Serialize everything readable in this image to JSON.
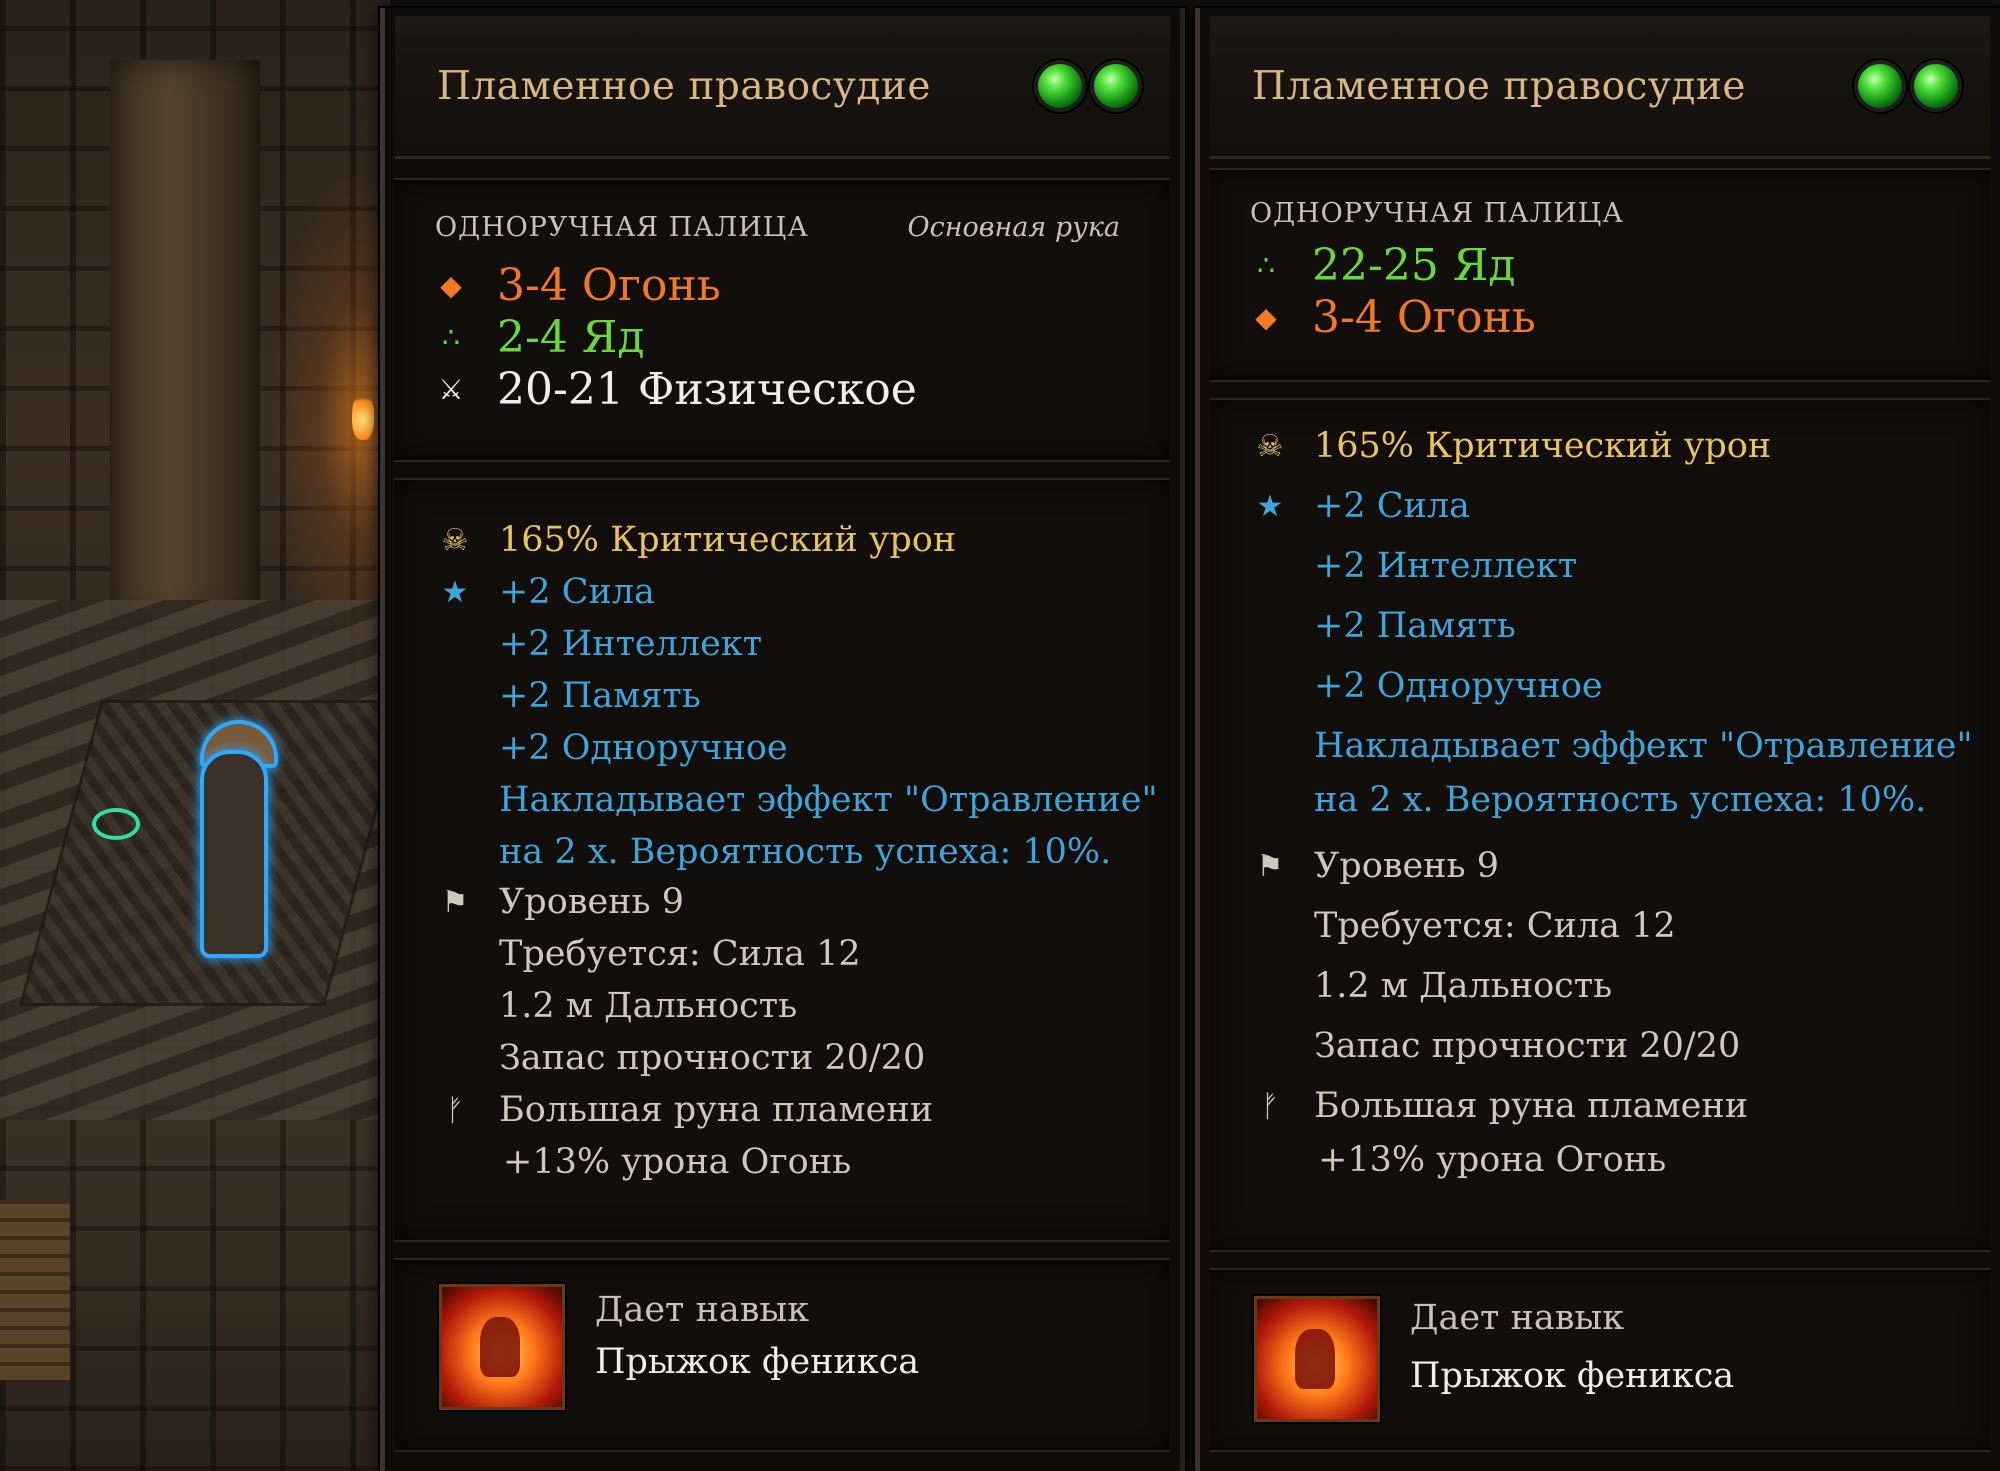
{
  "left_panel": {
    "title": "Пламенное правосудие",
    "weapon_type": "ОДНОРУЧНАЯ ПАЛИЦА",
    "hand": "Основная рука",
    "damage": [
      {
        "icon": "fire-icon",
        "text": "3-4 Огонь",
        "color": "#f07a22"
      },
      {
        "icon": "poison-icon",
        "text": "2-4 Яд",
        "color": "#6ad83a"
      },
      {
        "icon": "crossed-swords-icon",
        "text": "20-21 Физическое",
        "color": "#f2eee6"
      }
    ],
    "crit": "165% Критический урон",
    "bonuses": [
      "+2 Сила",
      "+2 Интеллект",
      "+2 Память",
      "+2 Одноручное"
    ],
    "effect_line1": "Накладывает эффект \"Отравление\"",
    "effect_line2": "на 2 х. Вероятность успеха: 10%.",
    "level": "Уровень 9",
    "requires": "Требуется: Сила 12",
    "range": "1.2 м Дальность",
    "durability": "Запас прочности  20/20",
    "rune_name": "Большая руна пламени",
    "rune_bonus": "+13% урона Огонь",
    "skill_label": "Дает навык",
    "skill_name": "Прыжок феникса"
  },
  "right_panel": {
    "title": "Пламенное правосудие",
    "weapon_type": "ОДНОРУЧНАЯ ПАЛИЦА",
    "damage": [
      {
        "icon": "poison-icon",
        "text": "22-25 Яд",
        "color": "#6ad83a"
      },
      {
        "icon": "fire-icon",
        "text": "3-4 Огонь",
        "color": "#f07a22"
      }
    ],
    "crit": "165% Критический урон",
    "bonuses": [
      "+2 Сила",
      "+2 Интеллект",
      "+2 Память",
      "+2 Одноручное"
    ],
    "effect_line1": "Накладывает эффект \"Отравление\"",
    "effect_line2": "на 2 х. Вероятность успеха: 10%.",
    "level": "Уровень 9",
    "requires": "Требуется: Сила 12",
    "range": "1.2 м Дальность",
    "durability": "Запас прочности  20/20",
    "rune_name": "Большая руна пламени",
    "rune_bonus": "+13% урона Огонь",
    "skill_label": "Дает навык",
    "skill_name": "Прыжок феникса"
  },
  "colors": {
    "title": "#d9b784",
    "fire": "#f07a22",
    "poison": "#6ad83a",
    "physical": "#f2eee6",
    "crit": "#e7c45c",
    "bonus": "#3fa4d8",
    "neutral": "#cfc8bc",
    "rune_socket": "#2ec22e"
  }
}
